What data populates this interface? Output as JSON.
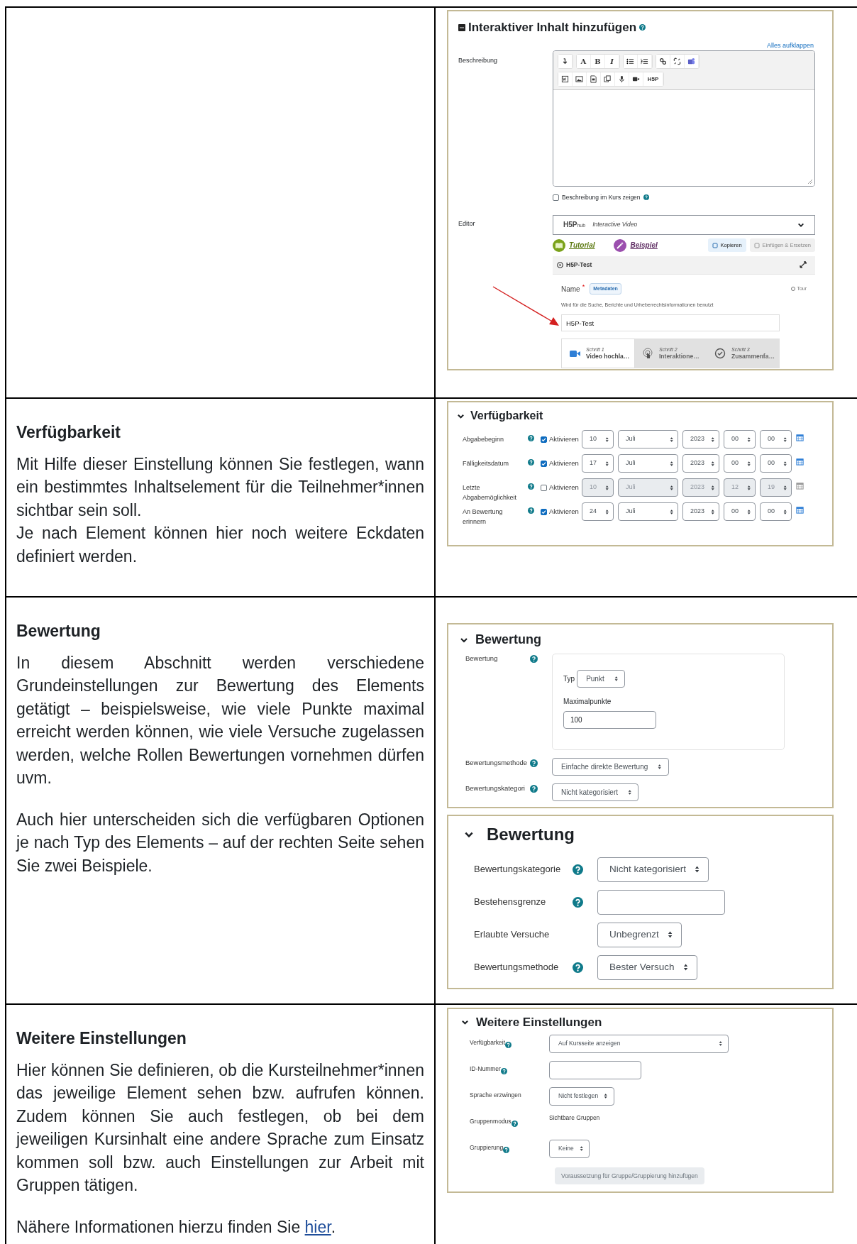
{
  "rows": [
    {
      "screenshots": [
        {
          "kind": "editor",
          "title": "Interaktiver Inhalt hinzufügen",
          "expand_link": "Alles aufklappen",
          "description_label": "Beschreibung",
          "toolbar": {
            "font": "A",
            "bold": "B",
            "italic": "I",
            "h5p": "H5P"
          },
          "show_description": {
            "label": "Beschreibung im Kurs zeigen",
            "checked": false
          },
          "editor_label": "Editor",
          "hub_logo": "H5P",
          "hub_logo_suffix": "hub",
          "content_type": "Interactive Video",
          "tutorial": "Tutorial",
          "example": "Beispiel",
          "copy_button": "Kopieren",
          "paste_button": "Einfügen & Ersetzen",
          "panel_title": "H5P-Test",
          "name_label": "Name",
          "required_mark": "*",
          "metadata_button": "Metadaten",
          "tour_link": "Tour",
          "name_hint": "Wird für die Suche, Berichte und Urheberrechtsinformationen benutzt",
          "name_value": "H5P-Test",
          "steps": [
            {
              "caption": "Schritt 1",
              "label": "Video hochla…",
              "selected": true
            },
            {
              "caption": "Schritt 2",
              "label": "Interaktione…",
              "selected": false
            },
            {
              "caption": "Schritt 3",
              "label": "Zusammenfa…",
              "selected": false
            }
          ]
        }
      ]
    },
    {
      "heading": "Verfügbarkeit",
      "paragraphs": [
        "Mit Hilfe dieser Einstellung können Sie festlegen, wann ein bestimmtes Inhaltselement für die Teilnehmer*innen sichtbar sein soll.\nJe nach Element können hier noch weitere Eckdaten definiert werden."
      ],
      "screenshots": [
        {
          "kind": "dates",
          "title": "Verfügbarkeit",
          "rows": [
            {
              "label": "Abgabebeginn",
              "enable_label": "Aktivieren",
              "checked": true,
              "day": "10",
              "month": "Juli",
              "year": "2023",
              "hour": "00",
              "minute": "00"
            },
            {
              "label": "Fälligkeitsdatum",
              "enable_label": "Aktivieren",
              "checked": true,
              "day": "17",
              "month": "Juli",
              "year": "2023",
              "hour": "00",
              "minute": "00"
            },
            {
              "label": "Letzte Abgabemöglichkeit",
              "enable_label": "Aktivieren",
              "checked": false,
              "day": "10",
              "month": "Juli",
              "year": "2023",
              "hour": "12",
              "minute": "19"
            },
            {
              "label": "An Bewertung erinnern",
              "enable_label": "Aktivieren",
              "checked": true,
              "day": "24",
              "month": "Juli",
              "year": "2023",
              "hour": "00",
              "minute": "00"
            }
          ]
        }
      ]
    },
    {
      "heading": "Bewertung",
      "paragraphs": [
        "In diesem Abschnitt werden verschiedene Grundeinstellungen zur Bewertung des Elements getätigt – beispielsweise, wie viele Punkte maximal erreicht werden können, wie viele Versuche zugelassen werden, welche Rollen Bewertungen vornehmen dürfen uvm.",
        "Auch hier unterscheiden sich die verfügbaren Optionen je nach Typ des Elements – auf der rechten Seite sehen Sie zwei Beispiele."
      ],
      "screenshots": [
        {
          "kind": "grading",
          "title": "Bewertung",
          "grade": {
            "label": "Bewertung",
            "type_label": "Typ",
            "type_value": "Punkt",
            "max_label": "Maximalpunkte",
            "max_value": "100"
          },
          "fields": [
            {
              "label": "Bewertungsmethode",
              "kind": "select",
              "value": "Einfache direkte Bewertung",
              "help": true
            },
            {
              "label": "Bewertungskategori",
              "kind": "select",
              "value": "Nicht kategorisiert",
              "help": true
            }
          ]
        },
        {
          "kind": "form_large",
          "title": "Bewertung",
          "fields": [
            {
              "label": "Bewertungskategorie",
              "kind": "select",
              "value": "Nicht kategorisiert",
              "help": true
            },
            {
              "label": "Bestehensgrenze",
              "kind": "input",
              "help": true
            },
            {
              "label": "Erlaubte Versuche",
              "kind": "select",
              "value": "Unbegrenzt",
              "help": false
            },
            {
              "label": "Bewertungsmethode",
              "kind": "select",
              "value": "Bester Versuch",
              "help": true
            }
          ]
        }
      ]
    },
    {
      "heading": "Weitere Einstellungen",
      "paragraphs": [
        "Hier können Sie definieren, ob die Kursteilnehmer*innen das jeweilige Element sehen bzw. aufrufen können. Zudem können Sie auch festlegen, ob bei dem jeweiligen Kursinhalt eine andere Sprache zum Einsatz kommen soll bzw. auch Einstellungen zur Arbeit mit Gruppen tätigen."
      ],
      "note": {
        "text": "Nähere Informationen hierzu finden Sie ",
        "link": "hier",
        "end": "."
      },
      "screenshots": [
        {
          "kind": "form_small",
          "title": "Weitere Einstellungen",
          "fields": [
            {
              "label": "Verfügbarkeit",
              "kind": "select",
              "value": "Auf Kursseite anzeigen",
              "help": true
            },
            {
              "label": "ID-Nummer",
              "kind": "input",
              "help": true
            },
            {
              "label": "Sprache erzwingen",
              "kind": "select",
              "value": "Nicht festlegen",
              "help": false
            },
            {
              "label": "Gruppenmodus",
              "kind": "static",
              "value": "Sichtbare Gruppen",
              "help": true
            },
            {
              "label": "Gruppierung",
              "kind": "select",
              "value": "Keine",
              "help": true
            }
          ],
          "button": "Voraussetzung für Gruppe/Gruppierung hinzufügen"
        }
      ]
    }
  ]
}
